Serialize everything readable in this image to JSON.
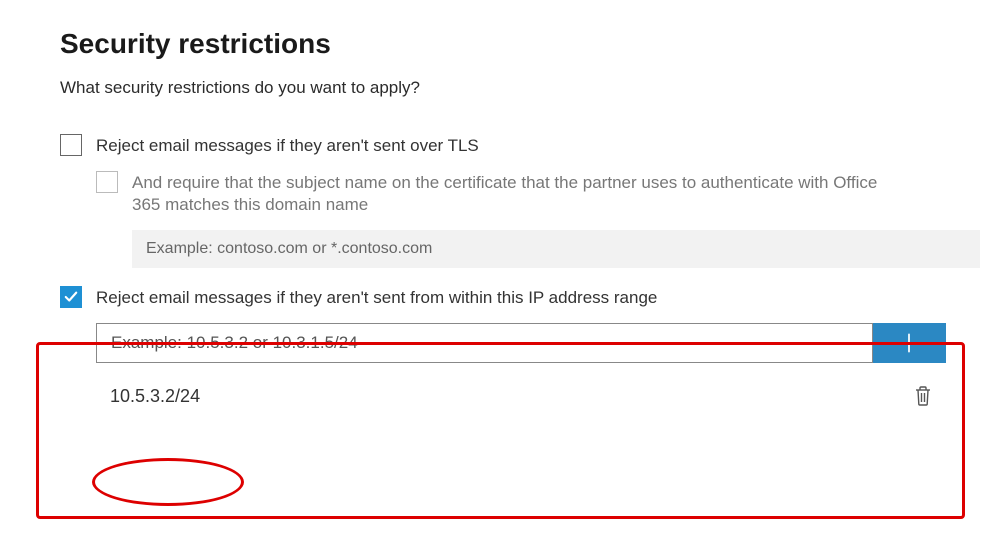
{
  "header": {
    "title": "Security restrictions",
    "subtitle": "What security restrictions do you want to apply?"
  },
  "tls_option": {
    "checked": false,
    "label": "Reject email messages if they aren't sent over TLS",
    "sub": {
      "checked": false,
      "disabled": true,
      "label": "And require that the subject name on the certificate that the partner uses to authenticate with Office 365 matches this domain name",
      "placeholder": "Example: contoso.com or *.contoso.com"
    }
  },
  "ip_option": {
    "checked": true,
    "label": "Reject email messages if they aren't sent from within this IP address range",
    "input_placeholder": "Example: 10.5.3.2 or 10.3.1.5/24",
    "entries": [
      {
        "value": "10.5.3.2/24"
      }
    ]
  },
  "icons": {
    "check": "check-icon",
    "plus": "plus-icon",
    "trash": "trash-icon"
  }
}
